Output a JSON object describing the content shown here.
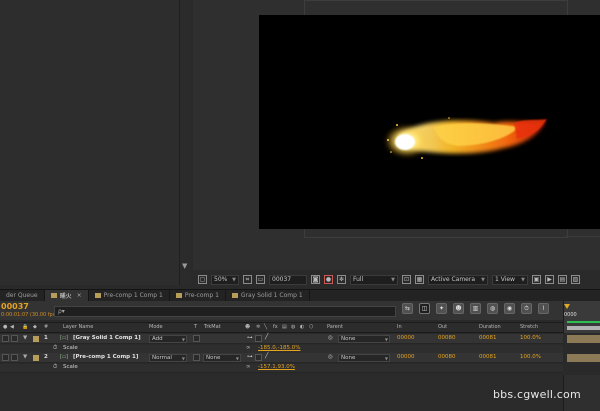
{
  "viewer": {
    "zoom": "50%",
    "timecode": "00037",
    "resolution": "Full",
    "camera": "Active Camera",
    "view_layout": "1 View"
  },
  "tabs": [
    {
      "label": "der Queue",
      "active": false
    },
    {
      "label": "晡火",
      "active": true
    },
    {
      "label": "Pre-comp 1 Comp 1",
      "active": false
    },
    {
      "label": "Pre-comp 1",
      "active": false
    },
    {
      "label": "Gray Solid 1 Comp 1",
      "active": false
    }
  ],
  "timeline": {
    "current_time": "00037",
    "fps_info": "0:00:01:07 (30.00 fps)",
    "search_placeholder": "ρ▾",
    "ruler_start": "0000",
    "columns": {
      "hash": "#",
      "layer_name": "Layer Name",
      "mode": "Mode",
      "t": "T",
      "trkmat": "TrkMat",
      "parent": "Parent",
      "in": "In",
      "out": "Out",
      "duration": "Duration",
      "stretch": "Stretch"
    },
    "layers": [
      {
        "num": "1",
        "name": "[Gray Solid 1 Comp 1]",
        "mode": "Add",
        "trkmat": "",
        "parent": "None",
        "in": "00000",
        "out": "00080",
        "duration": "00081",
        "stretch": "100.0%",
        "property": "Scale",
        "property_value": "-185.0,-185.0%"
      },
      {
        "num": "2",
        "name": "[Pre-comp 1 Comp 1]",
        "mode": "Normal",
        "trkmat": "None",
        "parent": "None",
        "in": "00000",
        "out": "00080",
        "duration": "00081",
        "stretch": "100.0%",
        "property": "Scale",
        "property_value": "-157.1,93.0%"
      }
    ]
  },
  "watermark": "bbs.cgwell.com",
  "colors": {
    "accent_orange": "#e5a31f",
    "label_swatch": "#b89d5a",
    "work_area_green": "#2dbf4f"
  }
}
